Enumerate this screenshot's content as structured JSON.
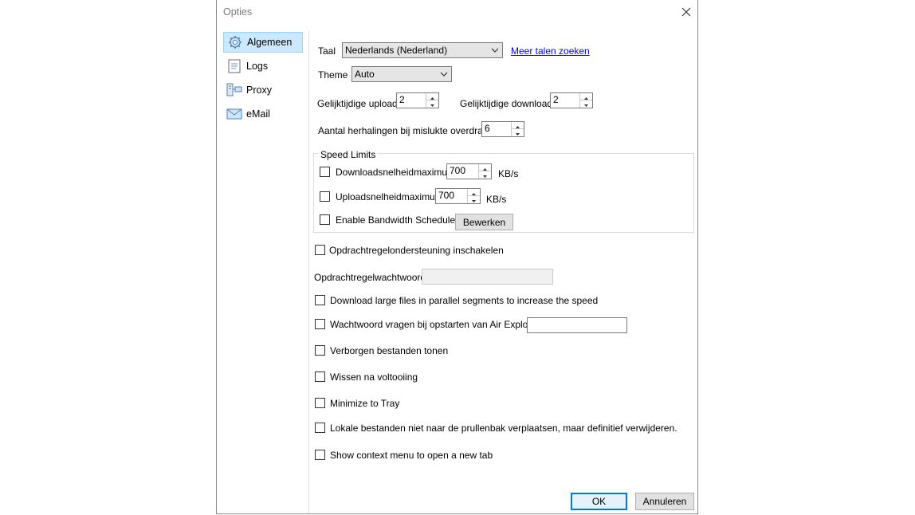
{
  "window": {
    "title": "Opties"
  },
  "sidebar": {
    "items": [
      {
        "label": "Algemeen",
        "icon": "gear-icon",
        "selected": true
      },
      {
        "label": "Logs",
        "icon": "log-icon"
      },
      {
        "label": "Proxy",
        "icon": "proxy-icon"
      },
      {
        "label": "eMail",
        "icon": "email-icon"
      }
    ]
  },
  "general": {
    "language_label": "Taal",
    "language_value": "Nederlands (Nederland)",
    "more_languages_link": "Meer talen zoeken",
    "theme_label": "Theme",
    "theme_value": "Auto",
    "uploads_label": "Gelijktijdige uploads",
    "uploads_value": "2",
    "downloads_label": "Gelijktijdige downloads",
    "downloads_value": "2",
    "retries_label": "Aantal herhalingen bij mislukte overdracht",
    "retries_value": "6"
  },
  "speed_limits": {
    "title": "Speed Limits",
    "download_label": "Downloadsnelheidmaximum",
    "download_value": "700",
    "download_unit": "KB/s",
    "upload_label": "Uploadsnelheidmaximum",
    "upload_value": "700",
    "upload_unit": "KB/s",
    "scheduler_label": "Enable Bandwidth Scheduler",
    "edit_button": "Bewerken"
  },
  "options": {
    "cmdline_support": "Opdrachtregelondersteuning inschakelen",
    "cmdline_password_label": "Opdrachtregelwachtwoord",
    "parallel_segments": "Download large files in parallel segments to increase the speed",
    "ask_password": "Wachtwoord vragen bij opstarten van Air Explorer",
    "show_hidden": "Verborgen bestanden tonen",
    "clear_after": "Wissen na voltooiing",
    "minimize_tray": "Minimize to Tray",
    "delete_permanently": "Lokale bestanden niet naar de prullenbak verplaatsen, maar definitief verwijderen.",
    "context_menu": "Show context menu to open a new tab"
  },
  "footer": {
    "ok": "OK",
    "cancel": "Annuleren"
  },
  "colors": {
    "accent": "#0078d7",
    "selection": "#cce8ff",
    "link": "#0000ee"
  }
}
